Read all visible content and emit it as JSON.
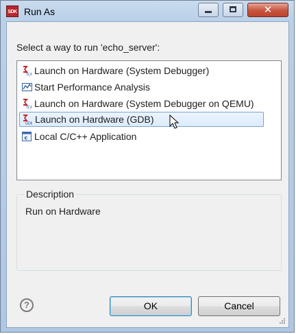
{
  "window": {
    "title": "Run As",
    "app_icon_text": "SDK"
  },
  "prompt": "Select a way to run 'echo_server':",
  "launch_options": [
    {
      "label": "Launch on Hardware (System Debugger)",
      "icon": "tcf-launch-icon",
      "selected": false
    },
    {
      "label": "Start Performance Analysis",
      "icon": "performance-chart-icon",
      "selected": false
    },
    {
      "label": "Launch on Hardware (System Debugger on QEMU)",
      "icon": "tcf-launch-icon",
      "selected": false
    },
    {
      "label": "Launch on Hardware (GDB)",
      "icon": "gdb-launch-icon",
      "selected": true
    },
    {
      "label": "Local C/C++ Application",
      "icon": "c-application-icon",
      "selected": false
    }
  ],
  "description": {
    "title": "Description",
    "text": "Run on Hardware"
  },
  "buttons": {
    "ok": "OK",
    "cancel": "Cancel",
    "help": "?"
  },
  "colors": {
    "selection_border": "#7da2ce",
    "selection_fill": "#dcebfc",
    "launch_icon_red": "#c0282d",
    "ok_default_border": "#3c7fb1"
  }
}
